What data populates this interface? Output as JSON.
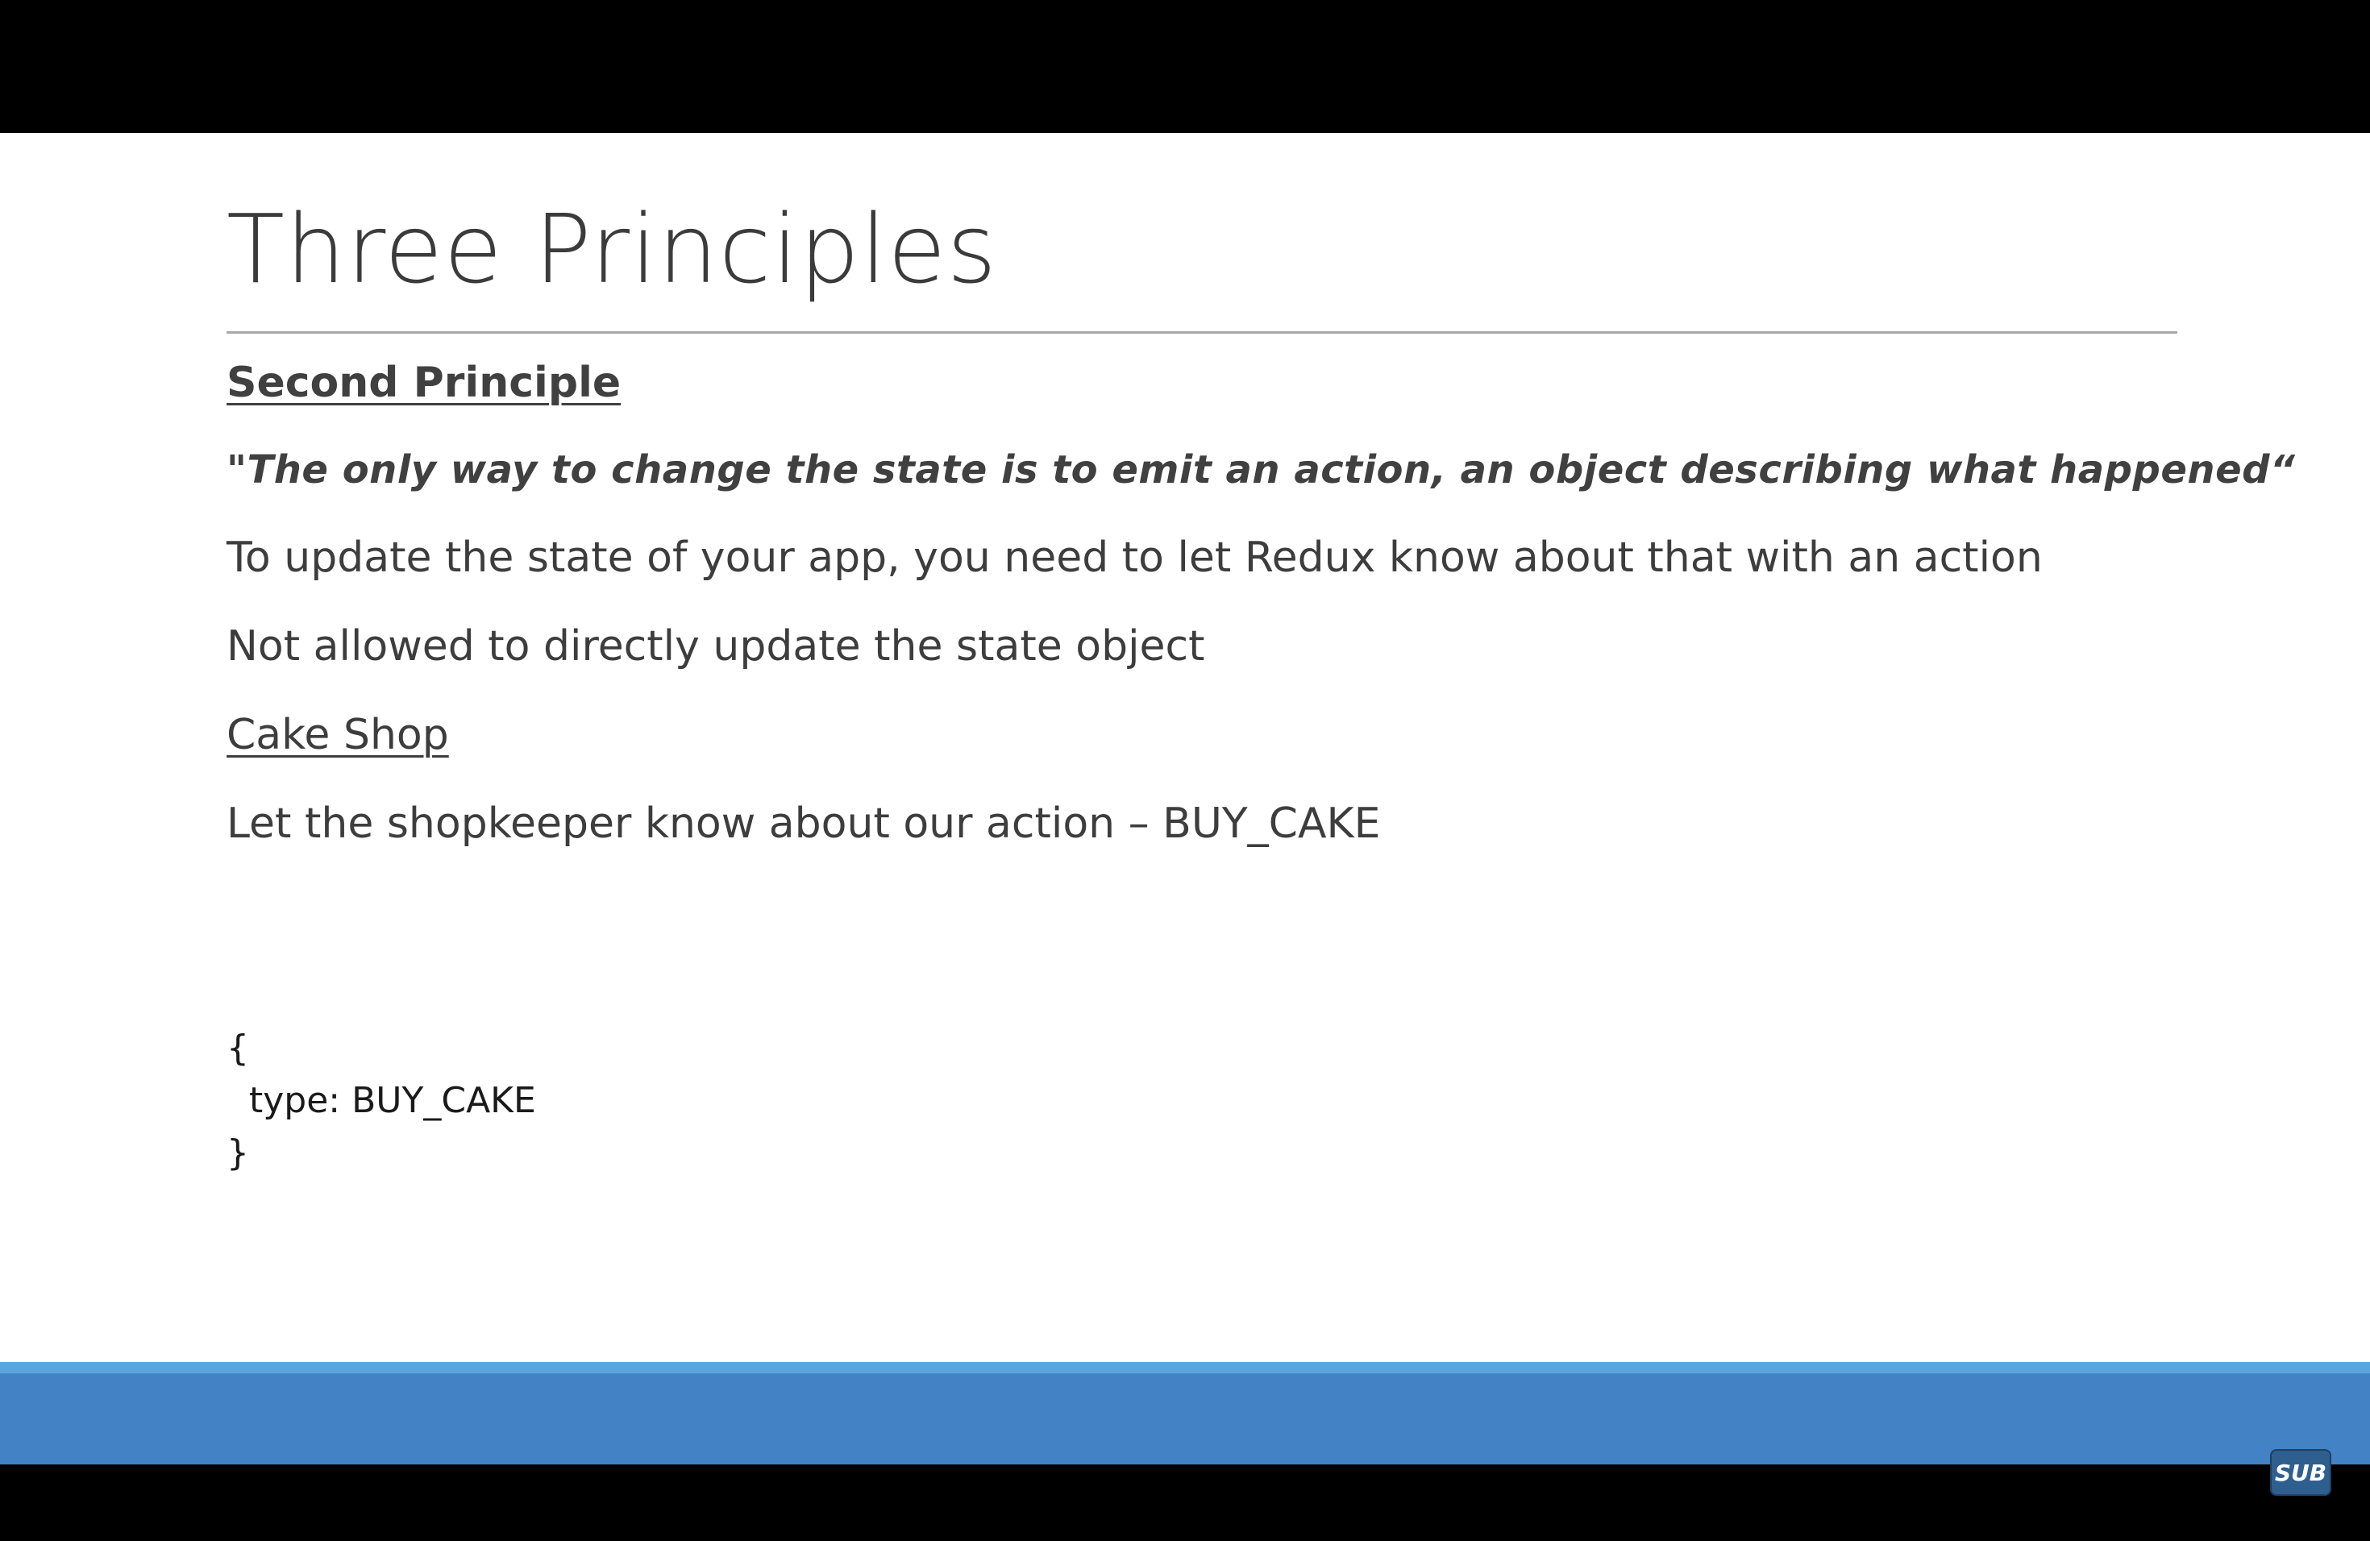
{
  "slide": {
    "title": "Three Principles",
    "subheading": "Second Principle",
    "quote": "\"The only way to change the state is to emit an action, an object describing what happened“",
    "lines": [
      "To update the state of your app, you need to let Redux know about that with an action",
      "Not allowed to directly update the state object",
      "Cake Shop",
      "Let the shopkeeper know about our action – BUY_CAKE"
    ],
    "code": [
      "{",
      "  type: BUY_CAKE",
      "}"
    ]
  },
  "overlay": {
    "badge_label": "SUB"
  },
  "colors": {
    "footer_band": "#4382c4",
    "footer_band_top": "#5aa6dc",
    "letterbox": "#000000"
  }
}
